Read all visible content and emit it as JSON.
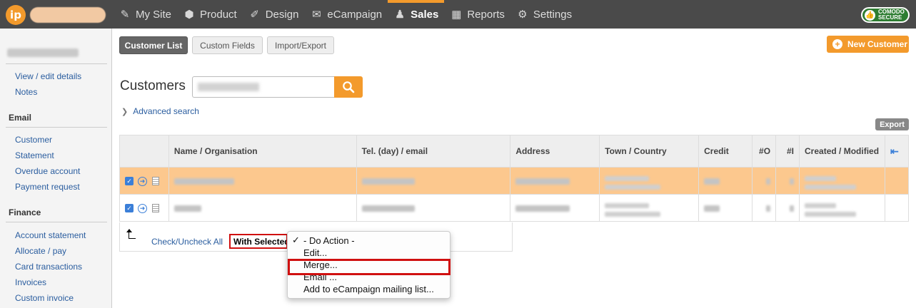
{
  "topbar": {
    "logo_text": "ip",
    "nav": [
      {
        "label": "My Site",
        "icon": "edit-icon",
        "glyph": "✎"
      },
      {
        "label": "Product",
        "icon": "cube-icon",
        "glyph": "⬢"
      },
      {
        "label": "Design",
        "icon": "pencil-ruler-icon",
        "glyph": "✐"
      },
      {
        "label": "eCampaign",
        "icon": "envelope-icon",
        "glyph": "✉"
      },
      {
        "label": "Sales",
        "icon": "people-chart-icon",
        "glyph": "♟"
      },
      {
        "label": "Reports",
        "icon": "bar-chart-icon",
        "glyph": "▦"
      },
      {
        "label": "Settings",
        "icon": "gear-icon",
        "glyph": "⚙"
      }
    ],
    "active_nav": "Sales",
    "badge": {
      "line1": "COMODO",
      "line2": "SECURE"
    }
  },
  "sidebar": {
    "customer_links": [
      "View / edit details",
      "Notes"
    ],
    "email_heading": "Email",
    "email_links": [
      "Customer",
      "Statement",
      "Overdue account",
      "Payment request"
    ],
    "finance_heading": "Finance",
    "finance_links": [
      "Account statement",
      "Allocate / pay",
      "Card transactions",
      "Invoices",
      "Custom invoice"
    ]
  },
  "main": {
    "tabs": [
      "Customer List",
      "Custom Fields",
      "Import/Export"
    ],
    "active_tab": "Customer List",
    "new_customer": "New Customer",
    "title": "Customers",
    "advanced_search": "Advanced search",
    "export": "Export"
  },
  "table": {
    "headers": [
      "Name / Organisation",
      "Tel. (day) / email",
      "Address",
      "Town / Country",
      "Credit",
      "#O",
      "#I",
      "Created / Modified"
    ]
  },
  "footer": {
    "check_all": "Check/Uncheck All",
    "with_selected": "With Selected"
  },
  "dropdown": {
    "items": [
      "- Do Action -",
      "Edit...",
      "Merge...",
      "Email ...",
      "Add to eCampaign mailing list..."
    ],
    "selected": "- Do Action -",
    "highlighted": "Merge..."
  },
  "colors": {
    "accent": "#f39a2c",
    "topbar": "#4a4a4a",
    "link": "#2a5d9f",
    "selected_row": "#fcc88e",
    "highlight_box": "#d01010"
  }
}
